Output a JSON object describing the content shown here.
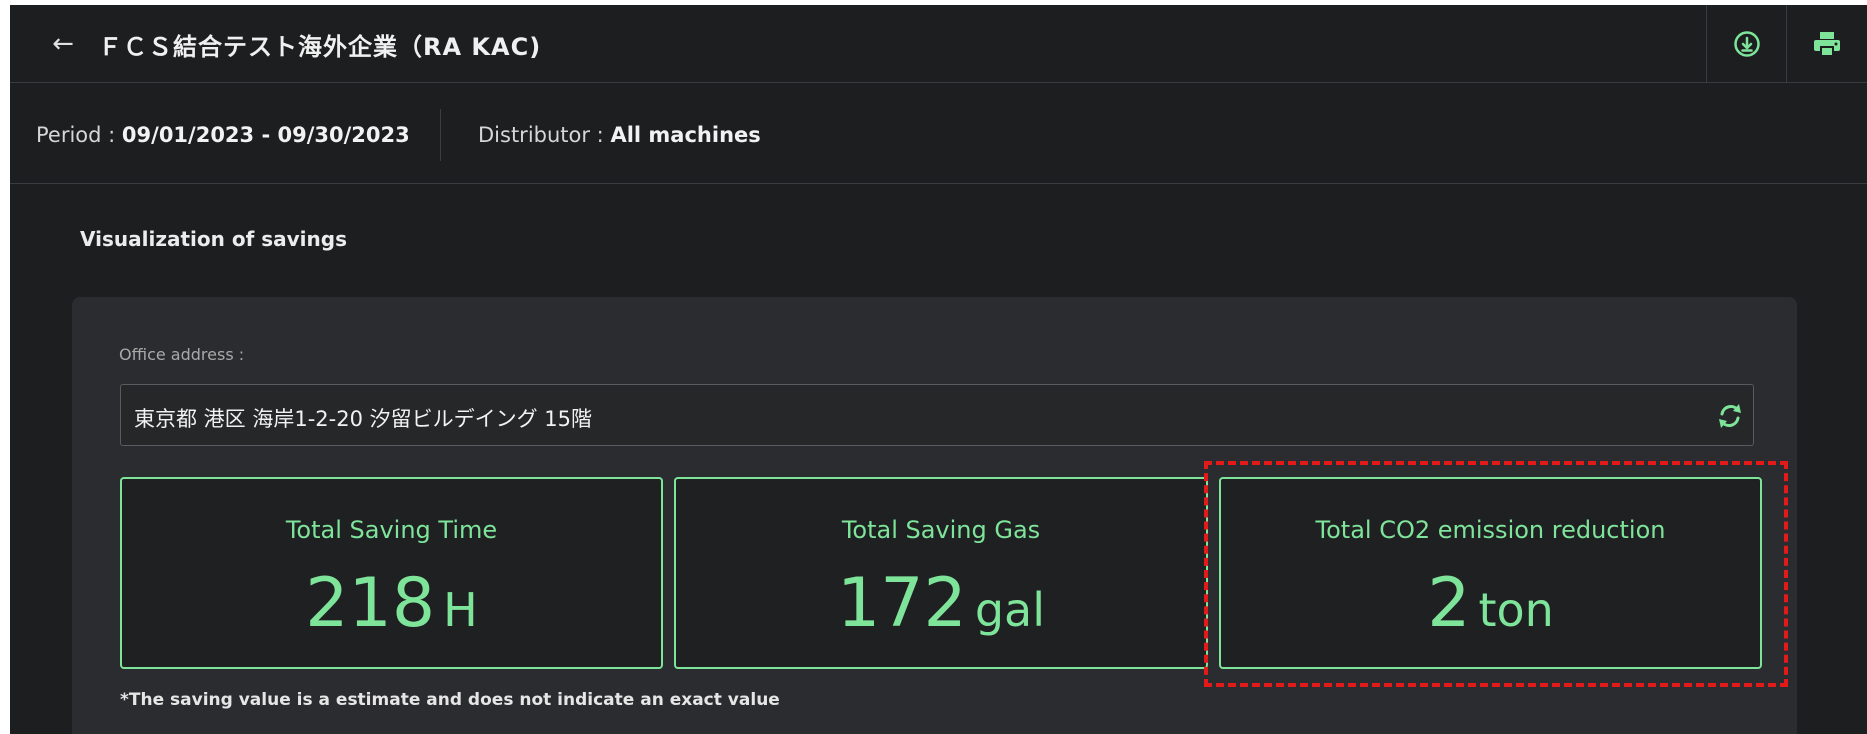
{
  "header": {
    "title": "ＦＣＳ結合テスト海外企業（RA KAC)",
    "back_icon": "arrow-left-icon",
    "download_icon": "download-circle-icon",
    "print_icon": "printer-icon"
  },
  "filters": {
    "period_label": "Period :",
    "period_value": "09/01/2023 - 09/30/2023",
    "distributor_label": "Distributor :",
    "distributor_value": "All machines"
  },
  "section": {
    "title": "Visualization of savings"
  },
  "office": {
    "label": "Office address :",
    "value": "東京都 港区 海岸1-2-20 汐留ビルデイング 15階",
    "sync_icon": "refresh-icon"
  },
  "cards": [
    {
      "title": "Total Saving Time",
      "value": "218",
      "unit": "H"
    },
    {
      "title": "Total Saving Gas",
      "value": "172",
      "unit": "gal"
    },
    {
      "title": "Total CO2 emission reduction",
      "value": "2",
      "unit": "ton"
    }
  ],
  "disclaimer": "*The saving value is a estimate and does not indicate an exact value",
  "colors": {
    "accent": "#7ee49a",
    "background": "#1d1e20",
    "panel": "#2b2c2f",
    "highlight": "#e21a1a"
  }
}
